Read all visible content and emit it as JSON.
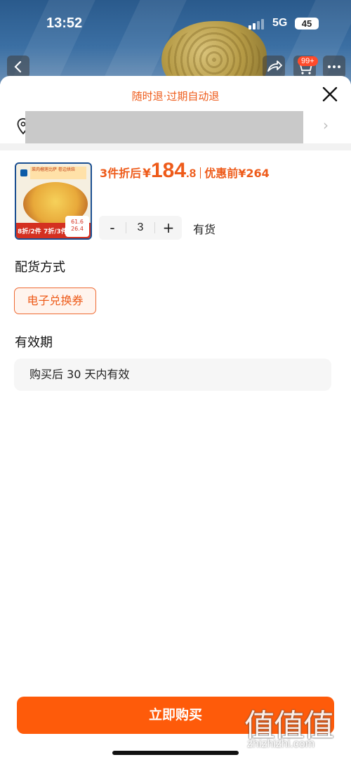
{
  "status_bar": {
    "time": "13:52",
    "network": "5G",
    "battery": "45"
  },
  "header": {
    "cart_badge": "99+"
  },
  "sheet": {
    "refund_policy": "随时退·过期自动退",
    "address_chevron": "›"
  },
  "product": {
    "thumbnail": {
      "title_text": "菜肉榴莲比萨 卷边烘焙",
      "promo_text": "8折/2件 7折/3件",
      "tag_top": "61.6",
      "tag_bottom": "26.4"
    },
    "deal_label": "3件折后",
    "currency": "¥",
    "price_int": "184",
    "price_dec": ".8",
    "original_label": "优惠前",
    "original_price": "¥264",
    "quantity": "3",
    "minus_label": "-",
    "plus_label": "+",
    "stock_status": "有货"
  },
  "delivery": {
    "title": "配货方式",
    "option": "电子兑换券"
  },
  "validity": {
    "title": "有效期",
    "text": "购买后 30 天内有效"
  },
  "actions": {
    "buy_label": "立即购买"
  },
  "watermark": {
    "main": "值值值",
    "site": "zhizhizhi.com"
  },
  "colors": {
    "accent": "#ee5b1a",
    "buy_button": "#fe5b0a"
  }
}
